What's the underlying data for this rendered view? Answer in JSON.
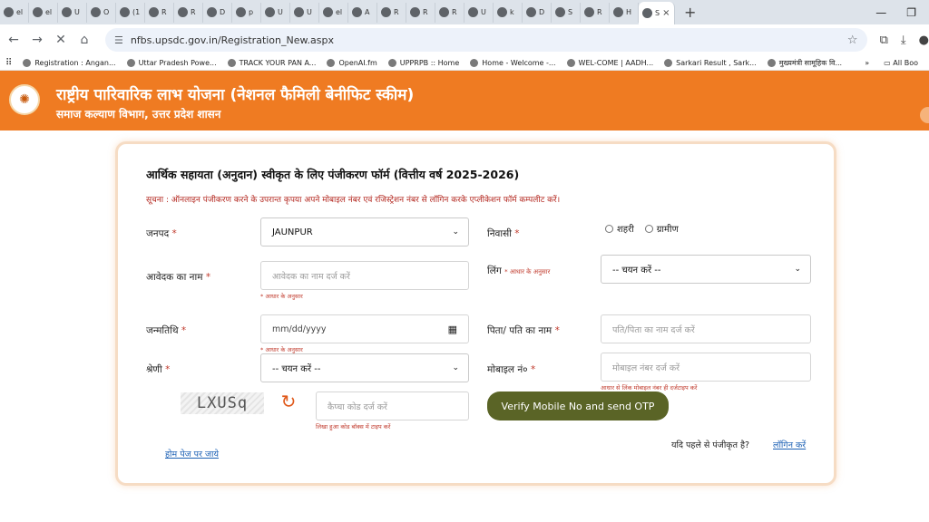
{
  "browser": {
    "tabs": [
      {
        "label": "el"
      },
      {
        "label": "el"
      },
      {
        "label": "U"
      },
      {
        "label": "O"
      },
      {
        "label": "(1"
      },
      {
        "label": "R"
      },
      {
        "label": "R"
      },
      {
        "label": "D"
      },
      {
        "label": "p"
      },
      {
        "label": "U"
      },
      {
        "label": "U"
      },
      {
        "label": "el"
      },
      {
        "label": "A"
      },
      {
        "label": "R"
      },
      {
        "label": "R"
      },
      {
        "label": "R"
      },
      {
        "label": "U"
      },
      {
        "label": "k"
      },
      {
        "label": "D"
      },
      {
        "label": "S"
      },
      {
        "label": "R"
      },
      {
        "label": "H"
      },
      {
        "label": "S"
      }
    ],
    "active_tab_close": "×",
    "new_tab": "+",
    "url": "nfbs.upsdc.gov.in/Registration_New.aspx",
    "bookmarks": [
      "Registration : Angan...",
      "Uttar Pradesh Powe...",
      "TRACK YOUR PAN A...",
      "OpenAI.fm",
      "UPPRPB :: Home",
      "Home - Welcome -...",
      "WEL-COME | AADH...",
      "Sarkari Result , Sark...",
      "मुख्यमंत्री सामूहिक वि..."
    ],
    "bookmarks_more": "»",
    "all_bookmarks": "All Boo"
  },
  "header": {
    "title": "राष्ट्रीय पारिवारिक लाभ योजना (नेशनल फैमिली बेनीफिट स्कीम)",
    "subtitle": "समाज कल्याण विभाग, उत्तर प्रदेश शासन"
  },
  "form": {
    "title": "आर्थिक सहायता (अनुदान) स्वीकृत के लिए पंजीकरण फॉर्म (वित्तीय वर्ष 2025-2026)",
    "notice": "सूचना : ऑनलाइन पंजीकरण करने के उपरान्त कृपया अपने मोबाइल नंबर एवं रजिस्ट्रेशन नंबर से लॉगिन करके एप्लीकेशन फॉर्म कम्पलीट करें।",
    "district": {
      "label": "जनपद",
      "value": "JAUNPUR"
    },
    "residence": {
      "label": "निवासी",
      "options": [
        "शहरी",
        "ग्रामीण"
      ]
    },
    "applicant_name": {
      "label": "आवेदक का नाम",
      "placeholder": "आवेदक का नाम दर्ज करें",
      "hint": "* आधार के अनुसार"
    },
    "gender": {
      "label": "लिंग",
      "sub_label": "* आधार के अनुसार",
      "value": "-- चयन करें --"
    },
    "dob": {
      "label": "जन्मतिथि",
      "placeholder": "mm/dd/yyyy",
      "hint": "* आधार के अनुसार"
    },
    "father_name": {
      "label": "पिता/ पति का नाम",
      "placeholder": "पति/पिता का नाम दर्ज करें"
    },
    "category": {
      "label": "श्रेणी",
      "value": "-- चयन करें --"
    },
    "mobile": {
      "label": "मोबाइल नं०",
      "placeholder": "मोबाइल नंबर दर्ज करें",
      "hint": "आधार से लिंक मोबाइल नंबर ही दर्जटाइप करें"
    },
    "captcha": {
      "image_text": "LXUSq",
      "placeholder": "कैप्चा कोड दर्ज करें",
      "hint": "लिखा हुआ कोड बॉक्स में टाइप करें"
    },
    "otp_button": "Verify Mobile No and send OTP",
    "home_link": "होम पेज पर जाये",
    "registered_question": "यदि पहले से पंजीकृत है?",
    "login_link": "लॉगिन करें",
    "required_mark": "*"
  }
}
